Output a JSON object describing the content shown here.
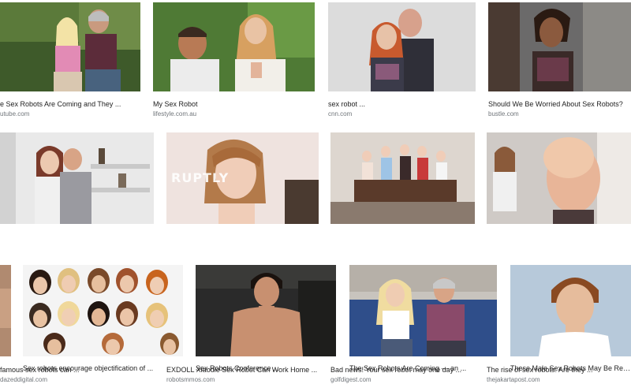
{
  "results": [
    {
      "title": "e Sex Robots Are Coming and They ...",
      "source": "utube.com"
    },
    {
      "title": "My Sex Robot",
      "source": "lifestyle.com.au"
    },
    {
      "title": "sex robot ...",
      "source": "cnn.com"
    },
    {
      "title": "Should We Be Worried About Sex Robots?",
      "source": "bustle.com"
    },
    {
      "title": "famous sex robots can ...",
      "source": "dazeddigital.com"
    },
    {
      "title": "EXDOLL Xiaodie Sex Robot Can Work Home ...",
      "source": "robotsmmos.com",
      "watermark": "RUPTLY"
    },
    {
      "title": "Bad news! Your sex robot may one day ...",
      "source": "golfdigest.com"
    },
    {
      "title": "The rise of sex robots: Are they ...",
      "source": "thejakartapost.com"
    },
    {
      "title": "Sex robots encourage objectification of ...",
      "source": ""
    },
    {
      "title": "Sex Robots Conference ...",
      "source": ""
    },
    {
      "title": "The Sex Robots Are Coming — an ...",
      "source": ""
    },
    {
      "title": "These Male Sex Robots May Be Repla...",
      "source": ""
    }
  ]
}
